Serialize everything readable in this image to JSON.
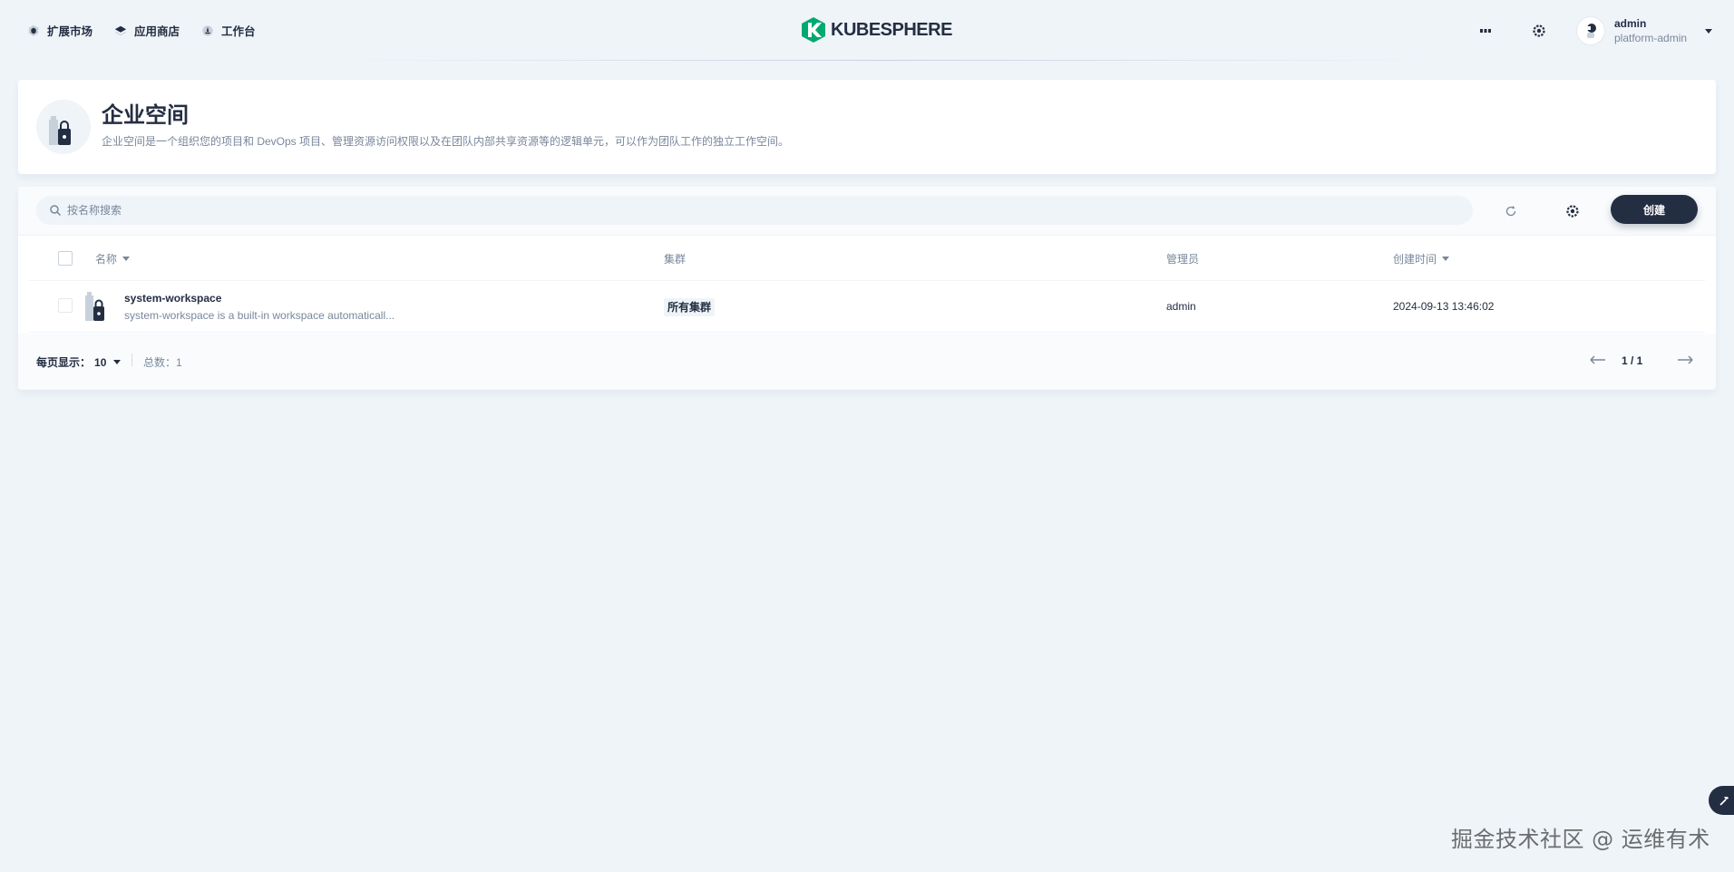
{
  "nav": {
    "items": [
      {
        "label": "扩展市场",
        "icon": "extension-market-icon"
      },
      {
        "label": "应用商店",
        "icon": "app-store-icon"
      },
      {
        "label": "工作台",
        "icon": "workbench-icon"
      }
    ],
    "brand": "KUBESPHERE",
    "user": {
      "name": "admin",
      "role": "platform-admin"
    }
  },
  "banner": {
    "title": "企业空间",
    "description": "企业空间是一个组织您的项目和 DevOps 项目、管理资源访问权限以及在团队内部共享资源等的逻辑单元，可以作为团队工作的独立工作空间。"
  },
  "toolbar": {
    "search_placeholder": "按名称搜索",
    "create_label": "创建"
  },
  "table": {
    "columns": {
      "name": "名称",
      "cluster": "集群",
      "manager": "管理员",
      "created": "创建时间"
    },
    "rows": [
      {
        "name": "system-workspace",
        "description": "system-workspace is a built-in workspace automaticall...",
        "cluster": "所有集群",
        "manager": "admin",
        "created": "2024-09-13 13:46:02"
      }
    ]
  },
  "footer": {
    "page_size_label": "每页显示：",
    "page_size": "10",
    "total_label": "总数：",
    "total": "1",
    "page_indicator": "1 / 1"
  },
  "watermark": "掘金技术社区 @ 运维有术",
  "colors": {
    "primary_dark": "#242e42",
    "background": "#eff4f9",
    "muted_text": "#79879c",
    "brand_green": "#00a971"
  }
}
